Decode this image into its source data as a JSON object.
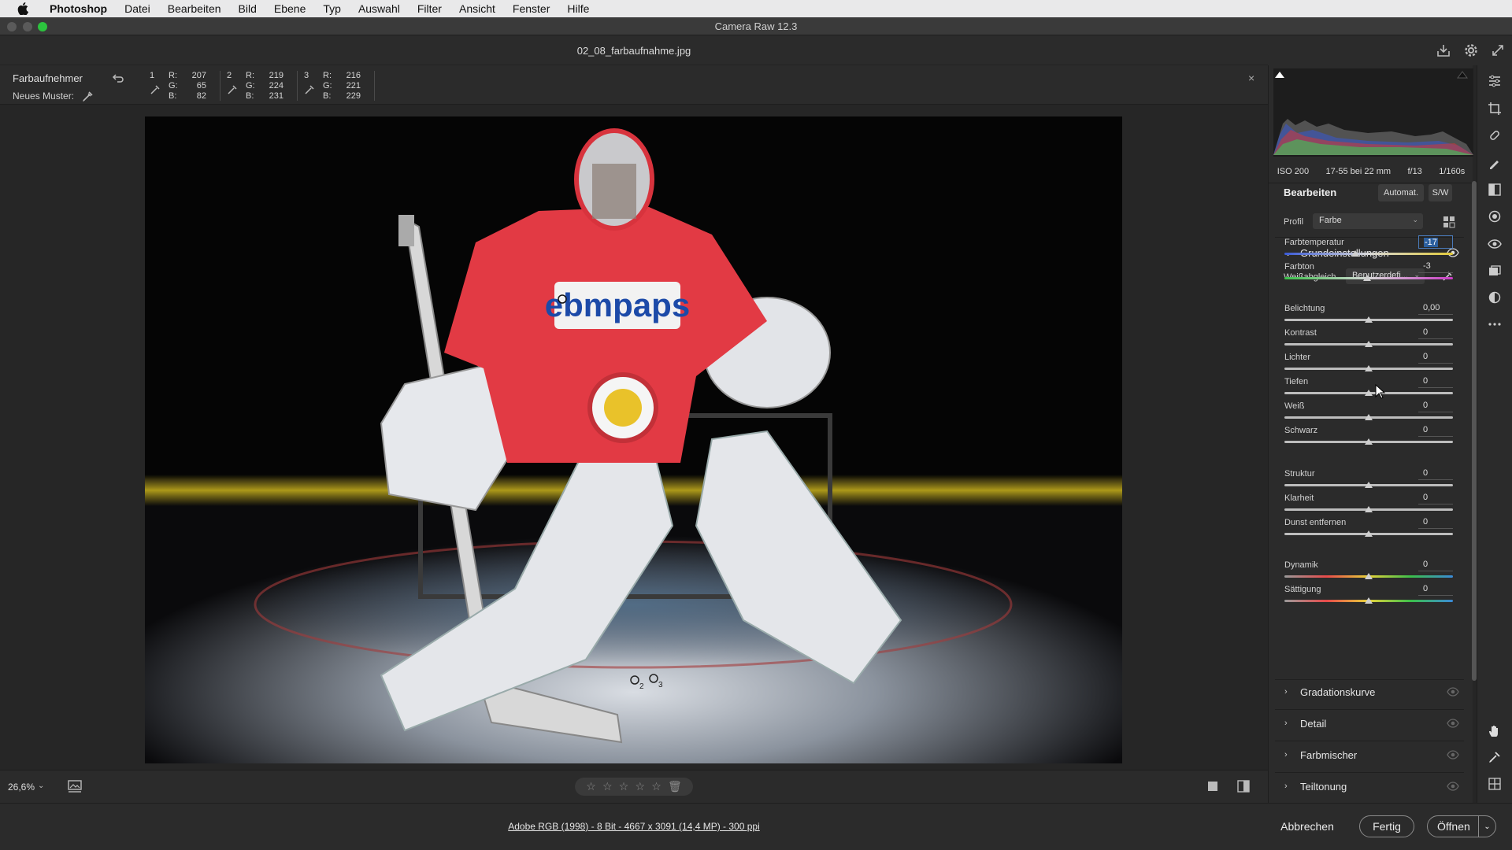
{
  "menubar": {
    "app": "Photoshop",
    "items": [
      "Datei",
      "Bearbeiten",
      "Bild",
      "Ebene",
      "Typ",
      "Auswahl",
      "Filter",
      "Ansicht",
      "Fenster",
      "Hilfe"
    ]
  },
  "window": {
    "title": "Camera Raw 12.3"
  },
  "document": {
    "filename": "02_08_farbaufnahme.jpg"
  },
  "sampler": {
    "tool_label": "Farbaufnehmer",
    "new_sample_label": "Neues Muster:",
    "samples": [
      {
        "num": "1",
        "r": "207",
        "g": "65",
        "b": "82"
      },
      {
        "num": "2",
        "r": "219",
        "g": "224",
        "b": "231"
      },
      {
        "num": "3",
        "r": "216",
        "g": "221",
        "b": "229"
      }
    ],
    "channel_labels": {
      "r": "R:",
      "g": "G:",
      "b": "B:"
    },
    "close": "×"
  },
  "canvas": {
    "jersey_text": "ebmpaps",
    "marker_2": "2",
    "marker_3": "3"
  },
  "bottom": {
    "zoom": "26,6%",
    "rating_max": 5
  },
  "footer": {
    "file_info": "Adobe RGB (1998) - 8 Bit - 4667 x 3091 (14,4 MP) - 300 ppi",
    "cancel": "Abbrechen",
    "done": "Fertig",
    "open": "Öffnen"
  },
  "exif": {
    "iso": "ISO 200",
    "lens": "17-55 bei 22 mm",
    "aperture": "f/13",
    "shutter": "1/160s"
  },
  "panel": {
    "title": "Bearbeiten",
    "auto": "Automat.",
    "bw": "S/W",
    "profile_label": "Profil",
    "profile_value": "Farbe",
    "basic_title": "Grundeinstellungen",
    "wb_label": "Weißabgleich",
    "wb_value": "Benutzerdefi...",
    "sliders": [
      {
        "label": "Farbtemperatur",
        "value": "-17",
        "pos": 0.42,
        "track": "temp",
        "active": true
      },
      {
        "label": "Farbton",
        "value": "-3",
        "pos": 0.49,
        "track": "tint"
      },
      {
        "label": "Belichtung",
        "value": "0,00",
        "pos": 0.5,
        "track": "plain"
      },
      {
        "label": "Kontrast",
        "value": "0",
        "pos": 0.5,
        "track": "plain"
      },
      {
        "label": "Lichter",
        "value": "0",
        "pos": 0.5,
        "track": "plain"
      },
      {
        "label": "Tiefen",
        "value": "0",
        "pos": 0.5,
        "track": "plain"
      },
      {
        "label": "Weiß",
        "value": "0",
        "pos": 0.5,
        "track": "plain"
      },
      {
        "label": "Schwarz",
        "value": "0",
        "pos": 0.5,
        "track": "plain"
      },
      {
        "label": "Struktur",
        "value": "0",
        "pos": 0.5,
        "track": "plain"
      },
      {
        "label": "Klarheit",
        "value": "0",
        "pos": 0.5,
        "track": "plain"
      },
      {
        "label": "Dunst entfernen",
        "value": "0",
        "pos": 0.5,
        "track": "plain"
      },
      {
        "label": "Dynamik",
        "value": "0",
        "pos": 0.5,
        "track": "sat"
      },
      {
        "label": "Sättigung",
        "value": "0",
        "pos": 0.5,
        "track": "sat"
      }
    ],
    "sections": [
      "Gradationskurve",
      "Detail",
      "Farbmischer",
      "Teiltonung"
    ]
  },
  "icons": {
    "tools": [
      "sliders-icon",
      "crop-icon",
      "healing-brush-icon",
      "brush-icon",
      "gradient-filter-icon",
      "radial-filter-icon",
      "red-eye-icon",
      "snapshots-icon",
      "presets-icon",
      "more-icon",
      "hand-icon",
      "color-sampler-icon",
      "grid-icon"
    ]
  },
  "colors": {
    "accent": "#2c5f9e",
    "panel": "#2b2b2b",
    "canvas": "#262626"
  }
}
